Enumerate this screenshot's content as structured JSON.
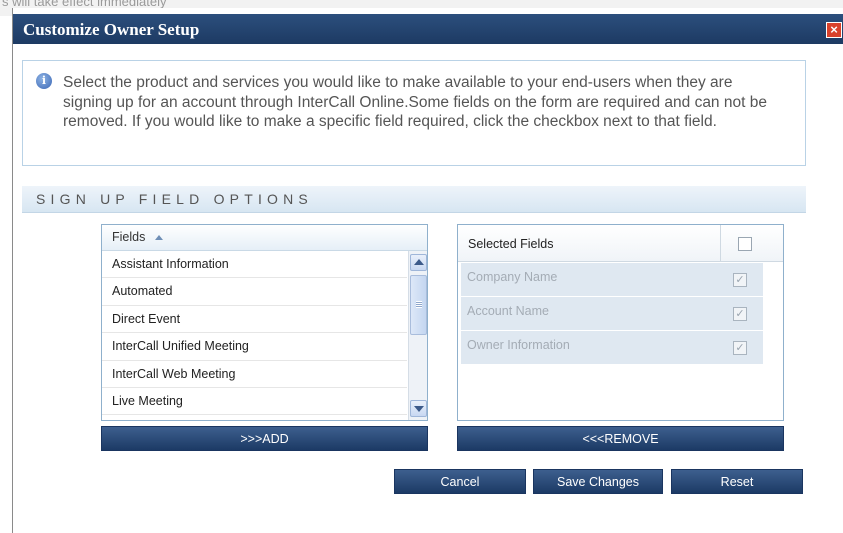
{
  "background": {
    "text": "s will take effect immediately"
  },
  "dialog": {
    "title": "Customize Owner Setup",
    "close_icon": "close-x-icon"
  },
  "info": {
    "icon": "info-icon",
    "text": "Select the product and services you would like to make available to your end-users when they are signing up for an account through InterCall Online.Some fields on the form are required and can not be removed. If you would like to make a specific field required, click the checkbox next to that field."
  },
  "section": {
    "title": "SIGN UP FIELD OPTIONS"
  },
  "fields_panel": {
    "header": "Fields",
    "sort_icon": "sort-ascending-icon",
    "items": [
      "Assistant Information",
      "Automated",
      "Direct Event",
      "InterCall Unified Meeting",
      "InterCall Web Meeting",
      "Live Meeting"
    ]
  },
  "selected_panel": {
    "header": "Selected Fields",
    "items": [
      {
        "label": "Company Name",
        "checked": true
      },
      {
        "label": "Account Name",
        "checked": true
      },
      {
        "label": "Owner Information",
        "checked": true
      }
    ]
  },
  "buttons": {
    "add": ">>>ADD",
    "remove": "<<<REMOVE",
    "cancel": "Cancel",
    "save": "Save Changes",
    "reset": "Reset"
  },
  "colors": {
    "title_bar": "#234670",
    "button": "#2c4c79",
    "section_header": "#dce9f4",
    "panel_border": "#8fb0cc"
  }
}
